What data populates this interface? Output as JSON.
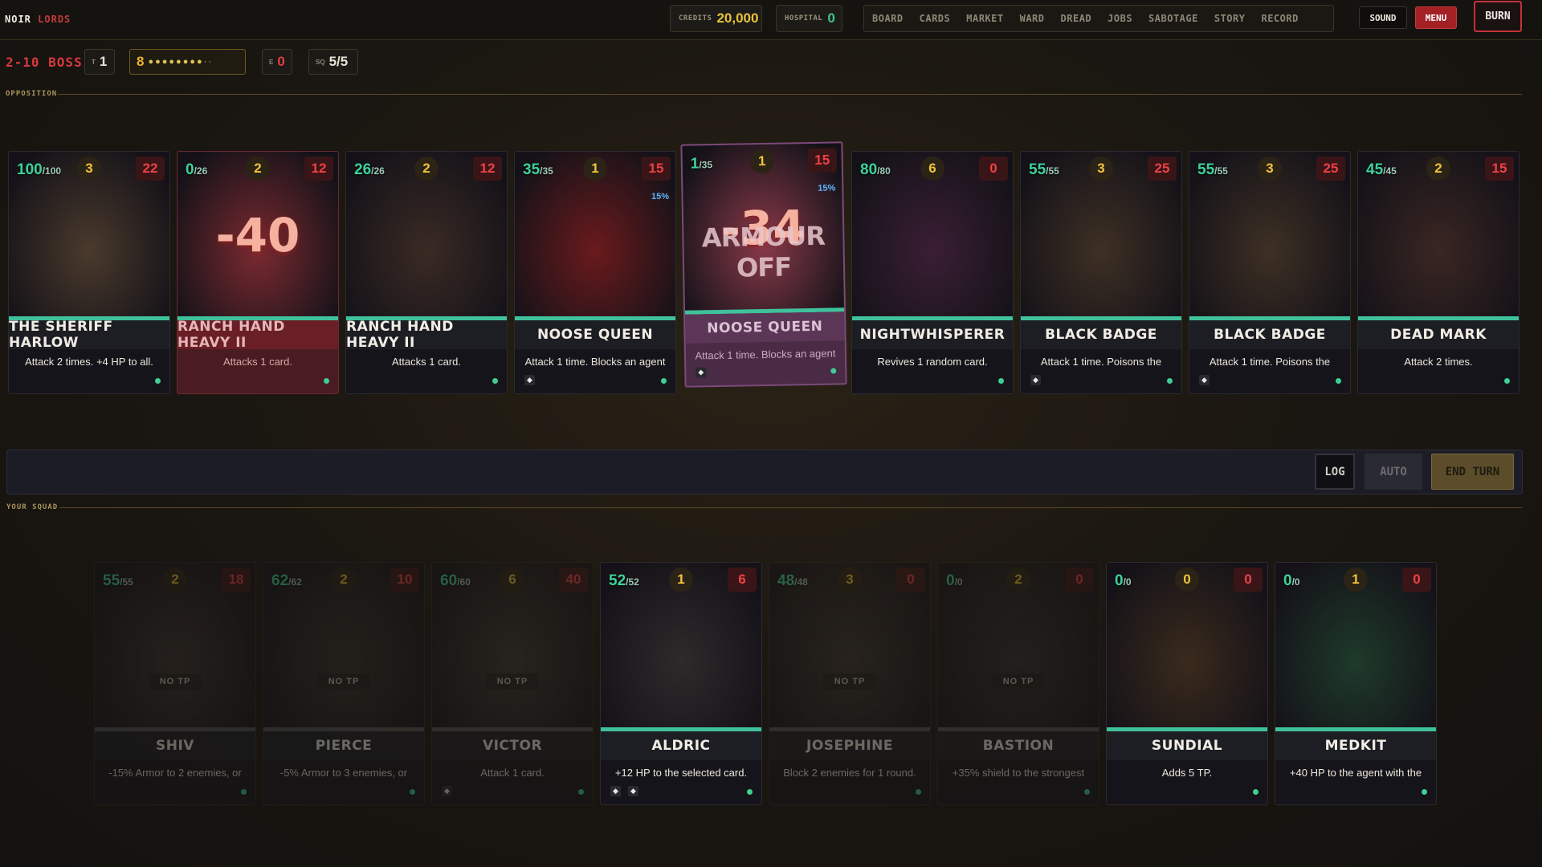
{
  "topbar": {
    "logo_a": "NOIR",
    "logo_b": "LORDS",
    "credits_label": "CREDITS",
    "credits_value": "20,000",
    "hospital_label": "HOSPITAL",
    "hospital_value": "0",
    "nav": [
      "BOARD",
      "CARDS",
      "MARKET",
      "WARD",
      "DREAD",
      "JOBS",
      "SABOTAGE",
      "STORY",
      "RECORD"
    ],
    "sound": "SOUND",
    "menu": "MENU",
    "burn": "BURN"
  },
  "status": {
    "stage": "2-10 BOSS",
    "turn_label": "T",
    "turn_value": "1",
    "energy_value": "8",
    "energy_dots": "●●●●●●●●··",
    "e_label": "E",
    "e_value": "0",
    "squad_label": "SQ",
    "squad_value": "5/5"
  },
  "sections": {
    "opposition": "OPPOSITION",
    "squad": "YOUR SQUAD"
  },
  "enemies": [
    {
      "hp": "100",
      "max": "/100",
      "speed": "3",
      "attack": "22",
      "name": "THE SHERIFF HARLOW",
      "desc": "Attack 2 times. +4 HP to all.",
      "state": "normal",
      "pct": "",
      "overlay": "",
      "diamonds": 0,
      "art_color": "#4a3a2c"
    },
    {
      "hp": "0",
      "max": "/26",
      "speed": "2",
      "attack": "12",
      "name": "RANCH HAND HEAVY II",
      "desc": "Attacks 1 card.",
      "state": "hurt",
      "pct": "",
      "overlay": "-40",
      "diamonds": 0,
      "art_color": "#7a2a30"
    },
    {
      "hp": "26",
      "max": "/26",
      "speed": "2",
      "attack": "12",
      "name": "RANCH HAND HEAVY II",
      "desc": "Attacks 1 card.",
      "state": "normal",
      "pct": "",
      "overlay": "",
      "diamonds": 0,
      "art_color": "#3a2a24"
    },
    {
      "hp": "35",
      "max": "/35",
      "speed": "1",
      "attack": "15",
      "name": "NOOSE QUEEN",
      "desc": "Attack 1 time. Blocks an agent",
      "state": "normal",
      "pct": "15%",
      "overlay": "",
      "diamonds": 1,
      "art_color": "#6a1a1c"
    },
    {
      "hp": "1",
      "max": "/35",
      "speed": "1",
      "attack": "15",
      "name": "NOOSE QUEEN",
      "desc": "Attack 1 time. Blocks an agent",
      "state": "selected",
      "pct": "15%",
      "overlay": "-34",
      "fx": "ARMOUR OFF",
      "diamonds": 1,
      "art_color": "#8a3a4a"
    },
    {
      "hp": "80",
      "max": "/80",
      "speed": "6",
      "attack": "0",
      "name": "NIGHTWHISPERER",
      "desc": "Revives 1 random card.",
      "state": "normal",
      "pct": "",
      "overlay": "",
      "diamonds": 0,
      "art_color": "#3a1e34"
    },
    {
      "hp": "55",
      "max": "/55",
      "speed": "3",
      "attack": "25",
      "name": "BLACK BADGE",
      "desc": "Attack 1 time. Poisons the",
      "state": "normal",
      "pct": "",
      "overlay": "",
      "diamonds": 1,
      "art_color": "#3e3024"
    },
    {
      "hp": "55",
      "max": "/55",
      "speed": "3",
      "attack": "25",
      "name": "BLACK BADGE",
      "desc": "Attack 1 time. Poisons the",
      "state": "normal",
      "pct": "",
      "overlay": "",
      "diamonds": 1,
      "art_color": "#3e3024"
    },
    {
      "hp": "45",
      "max": "/45",
      "speed": "2",
      "attack": "15",
      "name": "DEAD MARK",
      "desc": "Attack 2 times.",
      "state": "normal",
      "pct": "",
      "overlay": "",
      "diamonds": 0,
      "art_color": "#3a2622"
    }
  ],
  "actions": {
    "log": "LOG",
    "auto": "AUTO",
    "end_turn": "END TURN"
  },
  "squad": [
    {
      "hp": "55",
      "max": "/55",
      "speed": "2",
      "attack": "18",
      "name": "SHIV",
      "desc": "-15% Armor to 2 enemies, or",
      "state": "dim",
      "notp": "NO TP",
      "diamonds": 0,
      "art_color": "#3a3330"
    },
    {
      "hp": "62",
      "max": "/62",
      "speed": "2",
      "attack": "10",
      "name": "PIERCE",
      "desc": "-5% Armor to 3 enemies, or",
      "state": "dim",
      "notp": "NO TP",
      "diamonds": 0,
      "art_color": "#34302c"
    },
    {
      "hp": "60",
      "max": "/60",
      "speed": "6",
      "attack": "40",
      "name": "VICTOR",
      "desc": "Attack 1 card.",
      "state": "dim",
      "notp": "NO TP",
      "diamonds": 1,
      "art_color": "#3c3834"
    },
    {
      "hp": "52",
      "max": "/52",
      "speed": "1",
      "attack": "6",
      "name": "ALDRIC",
      "desc": "+12 HP to the selected card.",
      "state": "normal",
      "notp": "",
      "diamonds": 2,
      "art_color": "#2c2a2a"
    },
    {
      "hp": "48",
      "max": "/48",
      "speed": "3",
      "attack": "0",
      "name": "JOSEPHINE",
      "desc": "Block 2 enemies for 1 round.",
      "state": "dim",
      "notp": "NO TP",
      "diamonds": 0,
      "art_color": "#3a3532"
    },
    {
      "hp": "0",
      "max": "/0",
      "speed": "2",
      "attack": "0",
      "name": "BASTION",
      "desc": "+35% shield to the strongest",
      "state": "dim",
      "notp": "NO TP",
      "diamonds": 0,
      "art_color": "#2e3030"
    },
    {
      "hp": "0",
      "max": "/0",
      "speed": "0",
      "attack": "0",
      "name": "SUNDIAL",
      "desc": "Adds 5 TP.",
      "state": "normal",
      "notp": "",
      "diamonds": 0,
      "art_color": "#3a2a1c"
    },
    {
      "hp": "0",
      "max": "/0",
      "speed": "1",
      "attack": "0",
      "name": "MEDKIT",
      "desc": "+40 HP to the agent with the",
      "state": "normal",
      "notp": "",
      "diamonds": 0,
      "art_color": "#1e3a2a"
    }
  ]
}
